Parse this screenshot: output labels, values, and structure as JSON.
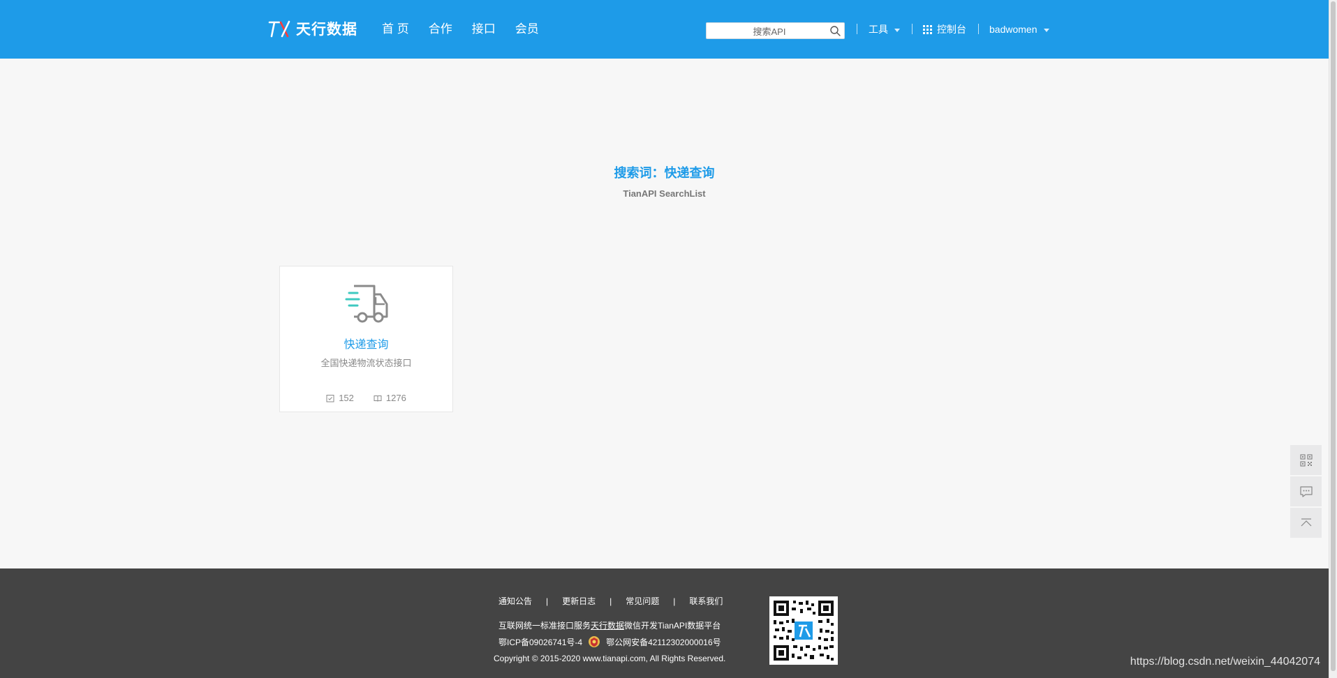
{
  "header": {
    "logo_text": "天行数据",
    "nav": [
      {
        "label": "首 页"
      },
      {
        "label": "合作"
      },
      {
        "label": "接口"
      },
      {
        "label": "会员"
      }
    ],
    "search": {
      "placeholder": "搜索API"
    },
    "tools_label": "工具",
    "console_label": "控制台",
    "user_label": "badwomen"
  },
  "main": {
    "title": "搜索词：快递查询",
    "subtitle": "TianAPI SearchList",
    "cards": [
      {
        "title": "快递查询",
        "description": "全国快递物流状态接口",
        "stat_a": "152",
        "stat_b": "1276",
        "icon": "delivery-truck-icon"
      }
    ]
  },
  "side_tools": [
    {
      "icon": "qrcode-icon"
    },
    {
      "icon": "chat-icon"
    },
    {
      "icon": "back-to-top-icon"
    }
  ],
  "footer": {
    "links": [
      "通知公告",
      "更新日志",
      "常见问题",
      "联系我们"
    ],
    "separator": "|",
    "line1_prefix": "互联网统一标准接口服务",
    "line1_brand": "天行数据",
    "line1_suffix": "微信开发TianAPI数据平台",
    "icp": "鄂ICP备09026741号-4",
    "police": "鄂公网安备42112302000016号",
    "copyright": "Copyright © 2015-2020 www.tianapi.com, All Rights Reserved."
  },
  "watermark": "https://blog.csdn.net/weixin_44042074",
  "colors": {
    "header_bg": "#1e9be8",
    "footer_bg": "#444444",
    "accent": "#1e9be8",
    "truck_accent": "#3ec9c0"
  }
}
